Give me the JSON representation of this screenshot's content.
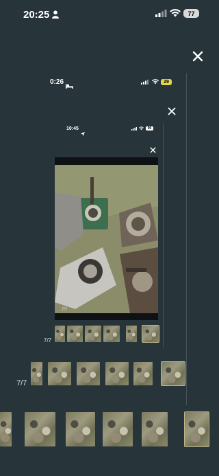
{
  "outer": {
    "status": {
      "time": "20:25",
      "battery": "77"
    },
    "counter": "7/7"
  },
  "middle": {
    "status": {
      "time": "0:26",
      "battery": "29"
    },
    "counter": "7/7"
  },
  "inner": {
    "status": {
      "time": "10:45",
      "battery": "90"
    },
    "counter": "7/7",
    "image_counter": "7/7"
  },
  "icons": {
    "close": "close-icon",
    "person": "person-icon",
    "bed": "bed-icon",
    "location": "location-arrow-icon"
  },
  "colors": {
    "background": "#27343a",
    "battery_outer": "#d9d9d9",
    "battery_middle": "#e8d64a",
    "active_thumb_border": "#c2b48a"
  }
}
